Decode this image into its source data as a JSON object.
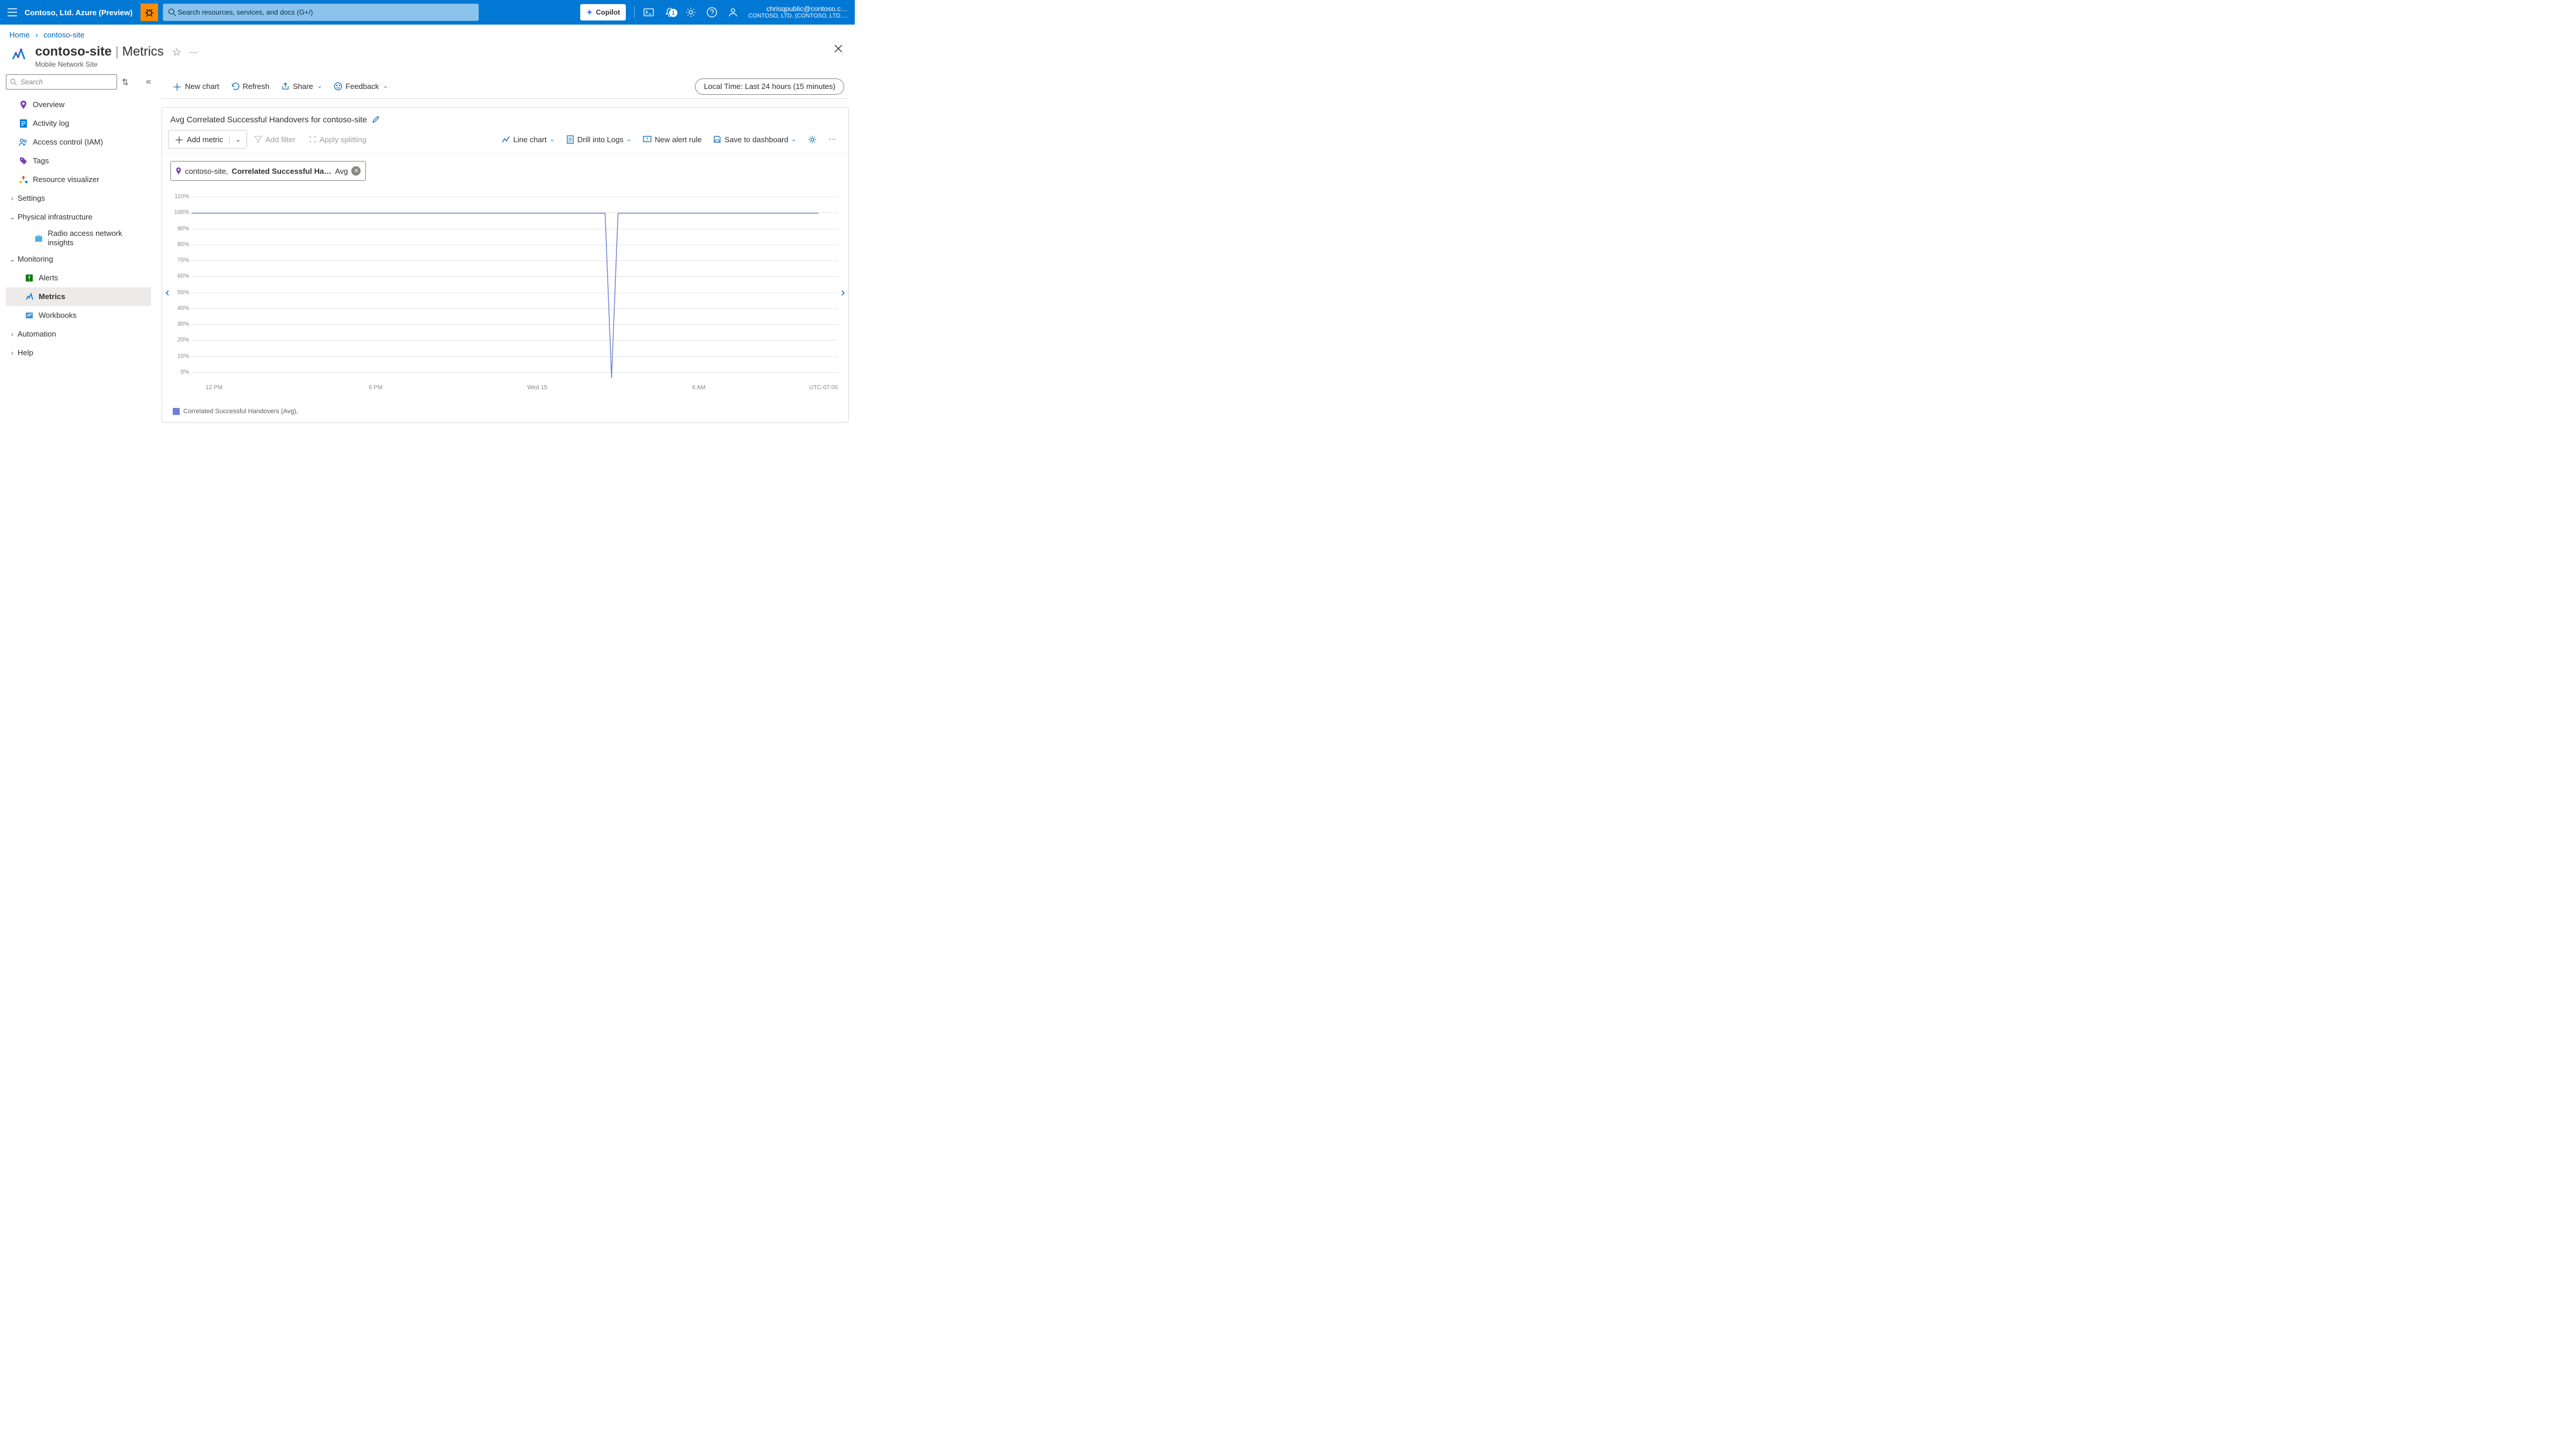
{
  "header": {
    "portal_title": "Contoso, Ltd. Azure (Preview)",
    "search_placeholder": "Search resources, services, and docs (G+/)",
    "copilot_label": "Copilot",
    "notif_count": "1",
    "user_email": "chrisqpublic@contoso.c…",
    "user_tenant": "CONTOSO, LTD. (CONTOSO, LTD.…"
  },
  "breadcrumb": {
    "home": "Home",
    "current": "contoso-site"
  },
  "blade": {
    "resource_name": "contoso-site",
    "separator": " | ",
    "page": "Metrics",
    "subtitle": "Mobile Network Site"
  },
  "sidebar": {
    "search_placeholder": "Search",
    "items": {
      "overview": "Overview",
      "activity": "Activity log",
      "iam": "Access control (IAM)",
      "tags": "Tags",
      "resviz": "Resource visualizer",
      "settings": "Settings",
      "phys": "Physical infrastructure",
      "ran": "Radio access network insights",
      "monitoring": "Monitoring",
      "alerts": "Alerts",
      "metrics": "Metrics",
      "workbooks": "Workbooks",
      "automation": "Automation",
      "help": "Help"
    }
  },
  "commands": {
    "new_chart": "New chart",
    "refresh": "Refresh",
    "share": "Share",
    "feedback": "Feedback",
    "time_pill": "Local Time: Last 24 hours (15 minutes)"
  },
  "card": {
    "title": "Avg Correlated Successful Handovers for contoso-site",
    "add_metric": "Add metric",
    "add_filter": "Add filter",
    "apply_splitting": "Apply splitting",
    "line_chart": "Line chart",
    "drill_logs": "Drill into Logs",
    "new_alert": "New alert rule",
    "save_dash": "Save to dashboard",
    "chip_scope": "contoso-site,",
    "chip_metric": "Correlated Successful Ha…",
    "chip_agg": "Avg",
    "legend": "Correlated Successful Handovers (Avg),"
  },
  "chart_data": {
    "type": "line",
    "title": "Avg Correlated Successful Handovers for contoso-site",
    "xlabel": "",
    "ylabel": "",
    "ylim": [
      0,
      110
    ],
    "y_ticks": [
      "110%",
      "100%",
      "90%",
      "80%",
      "70%",
      "60%",
      "50%",
      "40%",
      "30%",
      "20%",
      "10%",
      "0%"
    ],
    "x_ticks": [
      {
        "pos": 3.5,
        "label": "12 PM"
      },
      {
        "pos": 28.5,
        "label": "6 PM"
      },
      {
        "pos": 53.5,
        "label": "Wed 15"
      },
      {
        "pos": 78.5,
        "label": "6 AM"
      }
    ],
    "x_tz": "UTC-07:00",
    "series": [
      {
        "name": "Correlated Successful Handovers (Avg)",
        "color": "#6e7fd7",
        "values": [
          {
            "x": 0,
            "y": 100
          },
          {
            "x": 64,
            "y": 100
          },
          {
            "x": 65,
            "y": 0
          },
          {
            "x": 66,
            "y": 100
          },
          {
            "x": 97,
            "y": 100
          }
        ]
      }
    ]
  }
}
